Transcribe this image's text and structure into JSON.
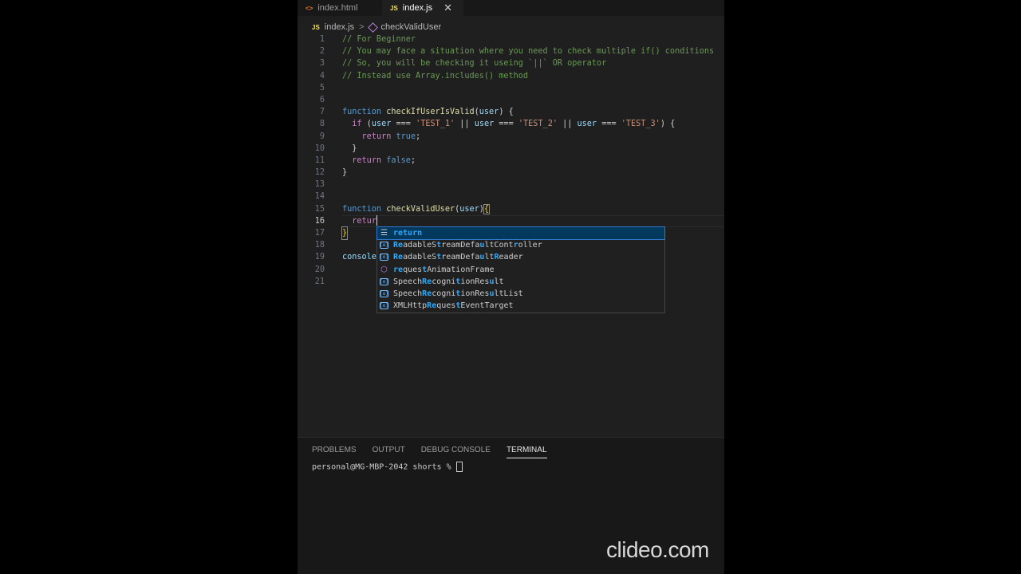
{
  "tabs": [
    {
      "icon": "<>",
      "label": "index.html",
      "active": false
    },
    {
      "icon": "JS",
      "label": "index.js",
      "active": true,
      "close": "✕"
    }
  ],
  "breadcrumb": {
    "file_icon": "JS",
    "file": "index.js",
    "separator": ">",
    "symbol": "checkValidUser"
  },
  "code": {
    "line_numbers": [
      "1",
      "2",
      "3",
      "4",
      "5",
      "6",
      "7",
      "8",
      "9",
      "10",
      "11",
      "12",
      "13",
      "14",
      "15",
      "16",
      "17",
      "18",
      "19",
      "20",
      "21"
    ],
    "active_line": "16",
    "line1": "// For Beginner",
    "line2": "// You may face a situation where you need to check multiple if() conditions",
    "line3": "// So, you will be checking it useing `||` OR operator",
    "line4": "// Instead use Array.includes() method",
    "l7": {
      "kw": "function",
      "fn": "checkIfUserIsValid",
      "open": "(",
      "param": "user",
      "close": ") {"
    },
    "l8": {
      "indent": "  ",
      "kw": "if",
      "t1": " (",
      "v1": "user",
      "t2": " === ",
      "s1": "'TEST_1'",
      "t3": " || ",
      "v2": "user",
      "t4": " === ",
      "s2": "'TEST_2'",
      "t5": " || ",
      "v3": "user",
      "t6": " === ",
      "s3": "'TEST_3'",
      "t7": ") {"
    },
    "l9": {
      "indent": "    ",
      "kw": "return",
      "sp": " ",
      "val": "true",
      "semi": ";"
    },
    "l10": {
      "text": "  }"
    },
    "l11": {
      "indent": "  ",
      "kw": "return",
      "sp": " ",
      "val": "false",
      "semi": ";"
    },
    "l12": {
      "text": "}"
    },
    "l15": {
      "kw": "function",
      "fn": "checkValidUser",
      "open": "(",
      "param": "user",
      "close": ")",
      "brace": "{"
    },
    "l16": {
      "indent": "  ",
      "typed": "retur"
    },
    "l17": {
      "text": "}"
    },
    "l19": {
      "text": "console"
    }
  },
  "suggestions": [
    {
      "icon": "keyword-icon",
      "pre": "",
      "hl1": "retur",
      "mid": "",
      "hl2": "n",
      "rest": ""
    },
    {
      "icon": "variable-icon",
      "text": "ReadableStreamDefaultController"
    },
    {
      "icon": "variable-icon",
      "text": "ReadableStreamDefaultReader"
    },
    {
      "icon": "method-icon",
      "text": "requestAnimationFrame"
    },
    {
      "icon": "variable-icon",
      "text": "SpeechRecognitionResult"
    },
    {
      "icon": "variable-icon",
      "text": "SpeechRecognitionResultList"
    },
    {
      "icon": "variable-icon",
      "text": "XMLHttpRequestEventTarget"
    }
  ],
  "panel": {
    "tabs": [
      "PROBLEMS",
      "OUTPUT",
      "DEBUG CONSOLE",
      "TERMINAL"
    ],
    "active_tab": "TERMINAL",
    "prompt": "personal@MG-MBP-2042 shorts % "
  },
  "watermark": "clideo.com",
  "colors": {
    "background": "#1f1f1f",
    "comment": "#6a9955",
    "keyword": "#569cd6",
    "function": "#dcdcaa",
    "string": "#ce9178",
    "selection": "#04395e"
  }
}
